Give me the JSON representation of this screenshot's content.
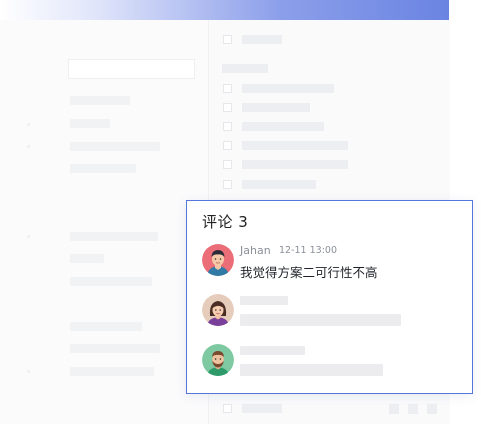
{
  "comments_dialog": {
    "title": "评论 3",
    "comments": [
      {
        "author": "Jahan",
        "time": "12-11 13:00",
        "text": "我觉得方案二可行性不高",
        "avatar": "man-blue-shirt-avatar"
      },
      {
        "author": "",
        "time": "",
        "text": "",
        "avatar": "woman-purple-avatar"
      },
      {
        "author": "",
        "time": "",
        "text": "",
        "avatar": "bearded-man-green-avatar"
      }
    ]
  },
  "colors": {
    "dialog_border": "#5676d9",
    "header_gradient_end": "#6a84e2",
    "placeholder": "#ececee"
  }
}
